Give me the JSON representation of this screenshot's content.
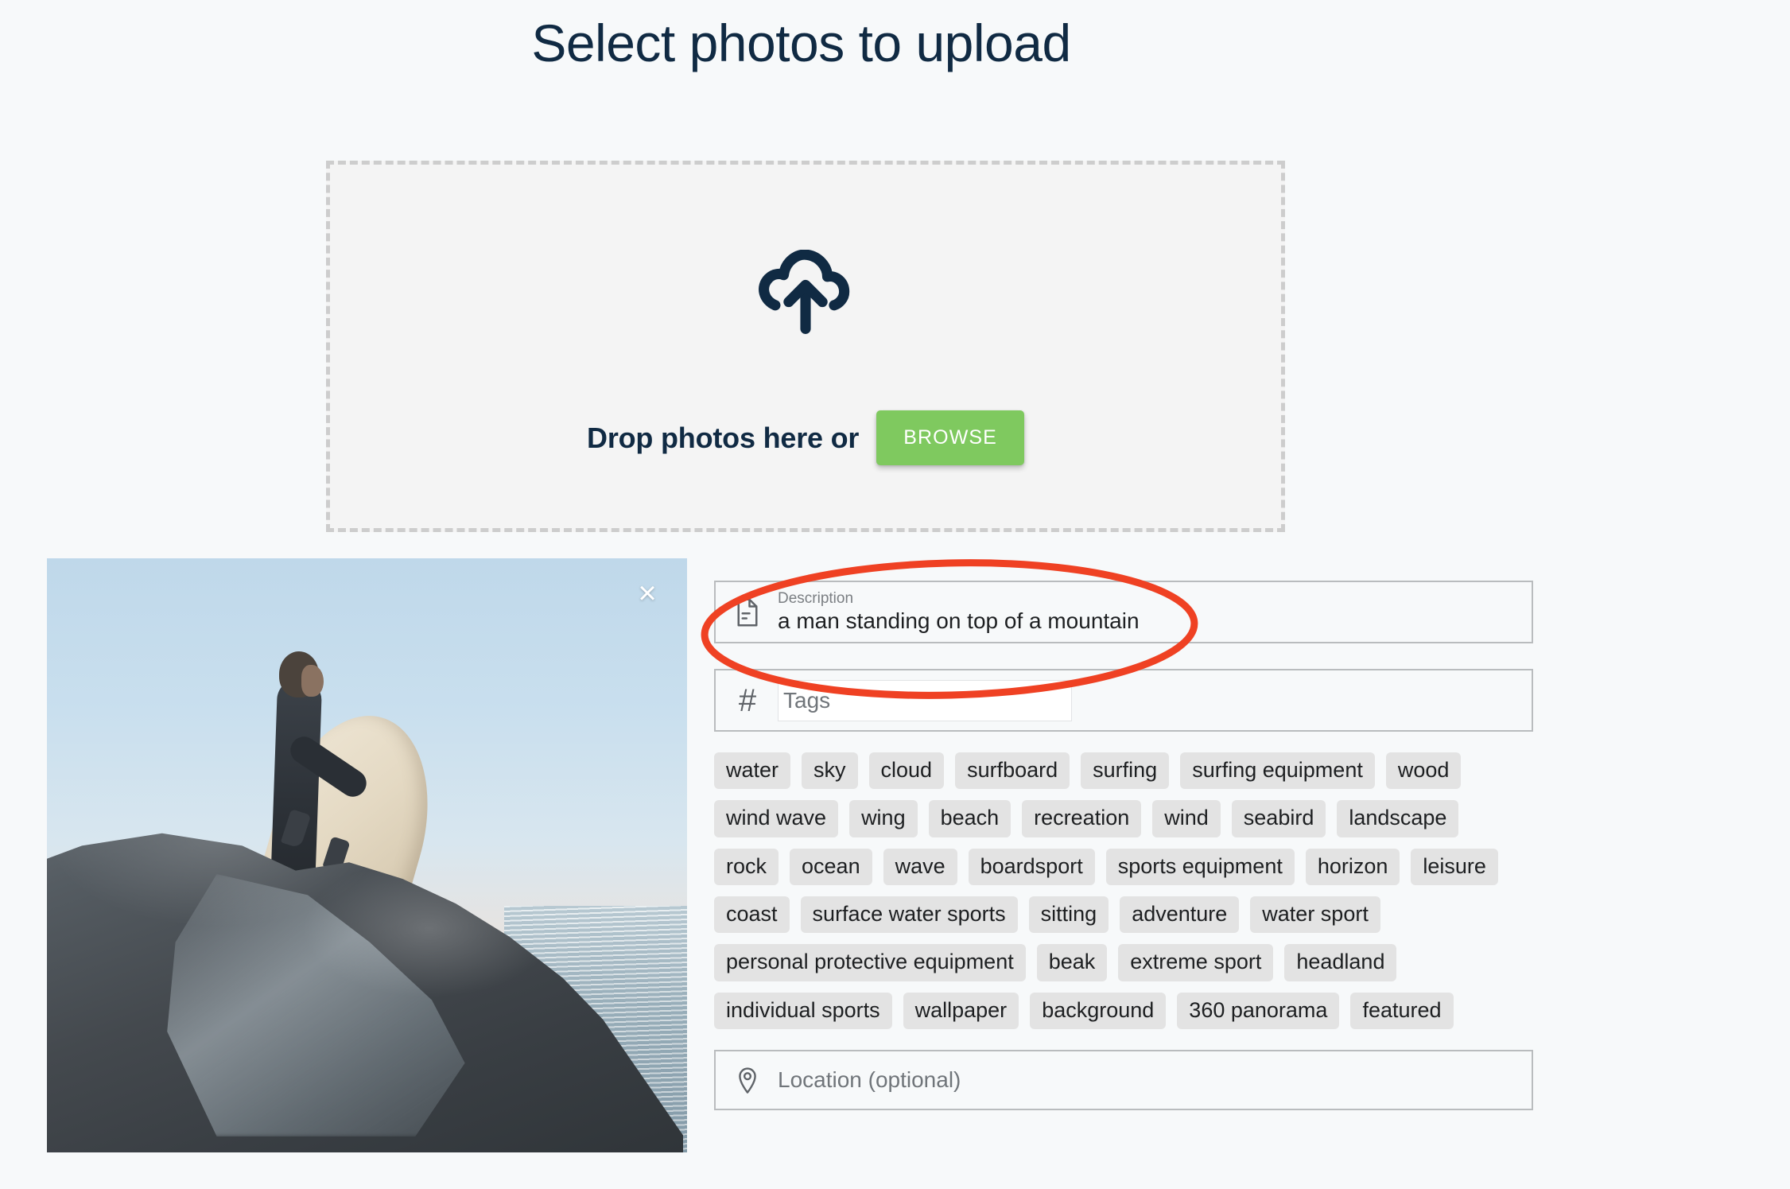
{
  "page": {
    "title": "Select photos to upload",
    "background_color": "#f7f9fa",
    "title_color": "#102a43"
  },
  "dropzone": {
    "icon": "cloud-upload-icon",
    "drop_text": "Drop photos here or",
    "browse_label": "BROWSE",
    "browse_color": "#7fc95f",
    "border_color": "#cdcdcd",
    "fill_color": "#f4f4f4"
  },
  "photo": {
    "close_label": "×",
    "alt_description": "surfer in wetsuit holding a surfboard standing on a rocky coastal cliff above the ocean"
  },
  "fields": {
    "description": {
      "icon": "document-icon",
      "label": "Description",
      "value": "a man standing on top of a mountain"
    },
    "tags": {
      "icon": "hash-icon",
      "placeholder": "Tags",
      "value": ""
    },
    "location": {
      "icon": "map-pin-icon",
      "placeholder": "Location (optional)",
      "value": ""
    }
  },
  "suggested_tags": [
    "water",
    "sky",
    "cloud",
    "surfboard",
    "surfing",
    "surfing equipment",
    "wood",
    "wind wave",
    "wing",
    "beach",
    "recreation",
    "wind",
    "seabird",
    "landscape",
    "rock",
    "ocean",
    "wave",
    "boardsport",
    "sports equipment",
    "horizon",
    "leisure",
    "coast",
    "surface water sports",
    "sitting",
    "adventure",
    "water sport",
    "personal protective equipment",
    "beak",
    "extreme sport",
    "headland",
    "individual sports",
    "wallpaper",
    "background",
    "360 panorama",
    "featured"
  ],
  "annotation": {
    "shape": "ellipse",
    "color": "#ef4123",
    "targets": "description-field"
  }
}
